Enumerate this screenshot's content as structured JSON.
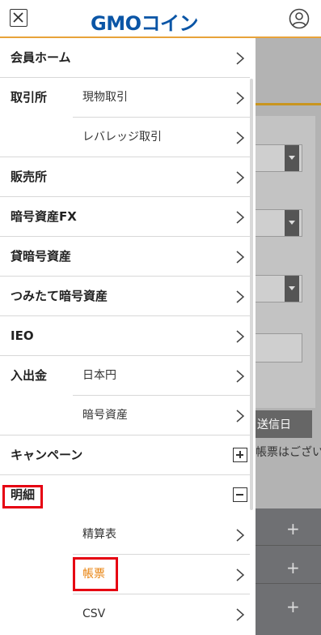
{
  "header": {
    "logo_text": "GMOコイン",
    "brand_color": "#0a55a6",
    "accent_color": "#e8a33a",
    "close_icon": "close-x-icon",
    "user_icon": "user-account-icon"
  },
  "menu": {
    "member_home": "会員ホーム",
    "exchange": "取引所",
    "exchange_spot": "現物取引",
    "exchange_leverage": "レバレッジ取引",
    "sales": "販売所",
    "crypto_fx": "暗号資産FX",
    "lending": "貸暗号資産",
    "tsumitate": "つみたて暗号資産",
    "ieo": "IEO",
    "deposit_withdraw": "入出金",
    "deposit_jpy": "日本円",
    "deposit_crypto": "暗号資産",
    "campaign": "キャンペーン",
    "statements": "明細",
    "statements_settlement": "精算表",
    "statements_ledger": "帳票",
    "statements_csv": "CSV"
  },
  "background": {
    "send_button": "送信日",
    "notice_text": "帳票はござい"
  },
  "highlight_color": "#e60012",
  "active_item_color": "#e8820c"
}
